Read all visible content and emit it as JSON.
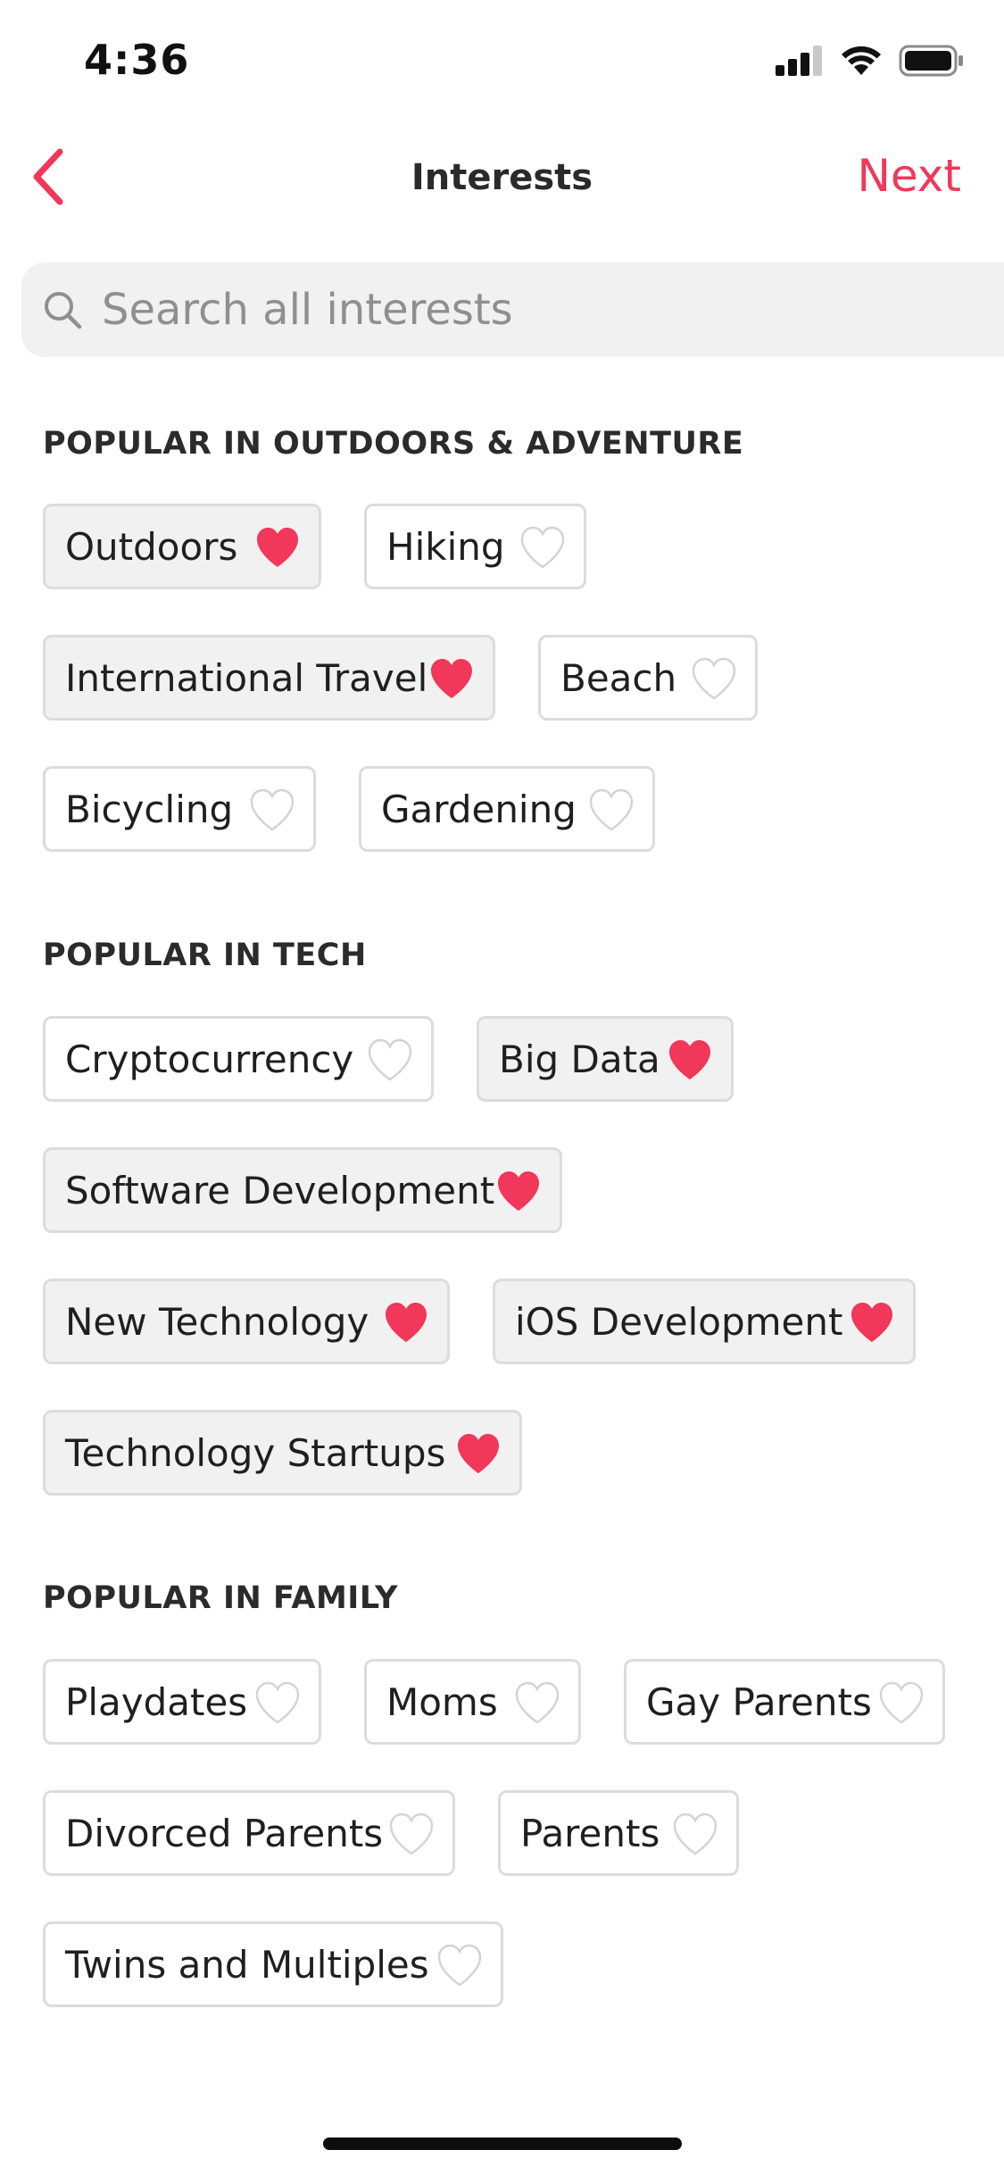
{
  "status_bar": {
    "time": "4:36"
  },
  "nav": {
    "title": "Interests",
    "next_label": "Next"
  },
  "search": {
    "placeholder": "Search all interests",
    "value": ""
  },
  "colors": {
    "accent": "#f1375a",
    "chip_selected_bg": "#f1f1f1",
    "chip_border": "#dcdcdc"
  },
  "sections": [
    {
      "title": "POPULAR IN OUTDOORS & ADVENTURE",
      "chips": [
        {
          "label": "Outdoors",
          "selected": true
        },
        {
          "label": "Hiking",
          "selected": false
        },
        {
          "label": "International Travel",
          "selected": true
        },
        {
          "label": "Beach",
          "selected": false
        },
        {
          "label": "Bicycling",
          "selected": false
        },
        {
          "label": "Gardening",
          "selected": false
        }
      ]
    },
    {
      "title": "POPULAR IN TECH",
      "chips": [
        {
          "label": "Cryptocurrency",
          "selected": false
        },
        {
          "label": "Big Data",
          "selected": true
        },
        {
          "label": "Software Development",
          "selected": true
        },
        {
          "label": "New Technology",
          "selected": true
        },
        {
          "label": "iOS Development",
          "selected": true
        },
        {
          "label": "Technology Startups",
          "selected": true
        }
      ]
    },
    {
      "title": "POPULAR IN FAMILY",
      "chips": [
        {
          "label": "Playdates",
          "selected": false
        },
        {
          "label": "Moms",
          "selected": false
        },
        {
          "label": "Gay Parents",
          "selected": false
        },
        {
          "label": "Divorced Parents",
          "selected": false
        },
        {
          "label": "Parents",
          "selected": false
        },
        {
          "label": "Twins and Multiples",
          "selected": false
        }
      ]
    }
  ]
}
